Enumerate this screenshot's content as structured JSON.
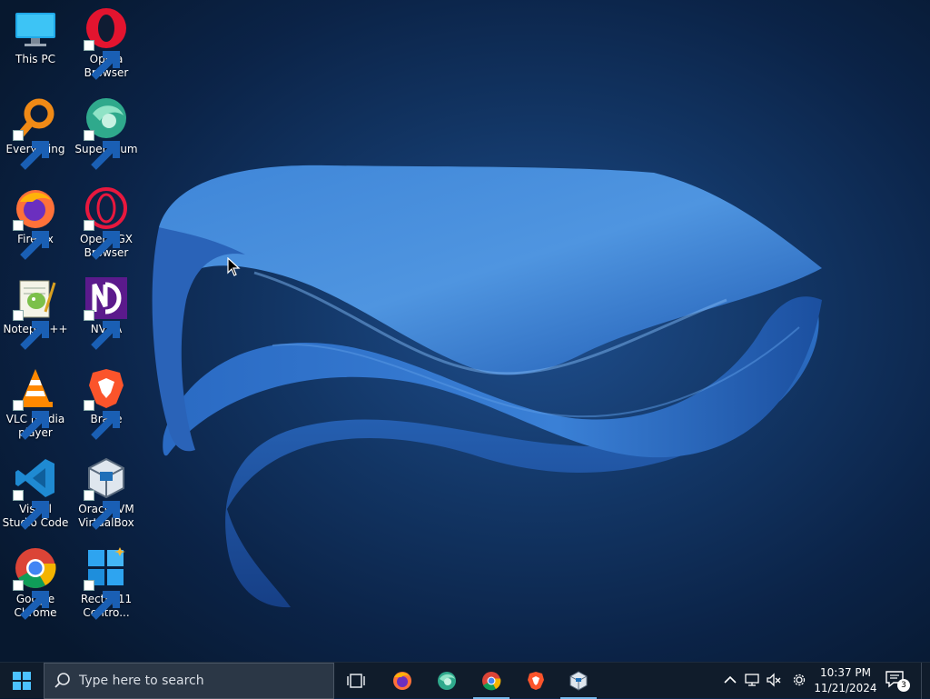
{
  "desktop": {
    "icons": [
      {
        "label": "This PC",
        "icon": "this-pc-icon",
        "shortcut": false
      },
      {
        "label": "Opera Browser",
        "icon": "opera-icon",
        "shortcut": true
      },
      {
        "label": "Everything",
        "icon": "everything-icon",
        "shortcut": true
      },
      {
        "label": "Supermium",
        "icon": "supermium-icon",
        "shortcut": true
      },
      {
        "label": "Firefox",
        "icon": "firefox-icon",
        "shortcut": true
      },
      {
        "label": "Opera GX Browser",
        "icon": "opera-gx-icon",
        "shortcut": true
      },
      {
        "label": "Notepad++",
        "icon": "notepad-plus-plus-icon",
        "shortcut": true
      },
      {
        "label": "NVDA",
        "icon": "nvda-icon",
        "shortcut": true
      },
      {
        "label": "VLC media player",
        "icon": "vlc-icon",
        "shortcut": true
      },
      {
        "label": "Brave",
        "icon": "brave-icon",
        "shortcut": true
      },
      {
        "label": "Visual Studio Code",
        "icon": "vscode-icon",
        "shortcut": true
      },
      {
        "label": "Oracle VM VirtualBox",
        "icon": "virtualbox-icon",
        "shortcut": true
      },
      {
        "label": "Google Chrome",
        "icon": "chrome-icon",
        "shortcut": true
      },
      {
        "label": "Rectify11 Contro...",
        "icon": "rectify11-control-panel-icon",
        "shortcut": true
      }
    ]
  },
  "taskbar": {
    "search_placeholder": "Type here to search",
    "pinned": [
      {
        "name": "task-view",
        "icon": "task-view-icon",
        "active": false
      },
      {
        "name": "firefox",
        "icon": "firefox-icon",
        "active": false
      },
      {
        "name": "supermium",
        "icon": "supermium-icon",
        "active": false
      },
      {
        "name": "chrome",
        "icon": "chrome-icon",
        "active": true
      },
      {
        "name": "brave",
        "icon": "brave-icon",
        "active": false
      },
      {
        "name": "virtualbox",
        "icon": "virtualbox-icon",
        "active": true
      }
    ],
    "tray": {
      "icons": [
        "chevron-up-icon",
        "network-icon",
        "volume-muted-icon",
        "settings-gear-icon"
      ],
      "time": "10:37 PM",
      "date": "11/21/2024",
      "notification_count": "3"
    }
  },
  "colors": {
    "taskbar_bg": "#101c2b",
    "search_bg": "#2b3746",
    "accent": "#76b9ed"
  }
}
